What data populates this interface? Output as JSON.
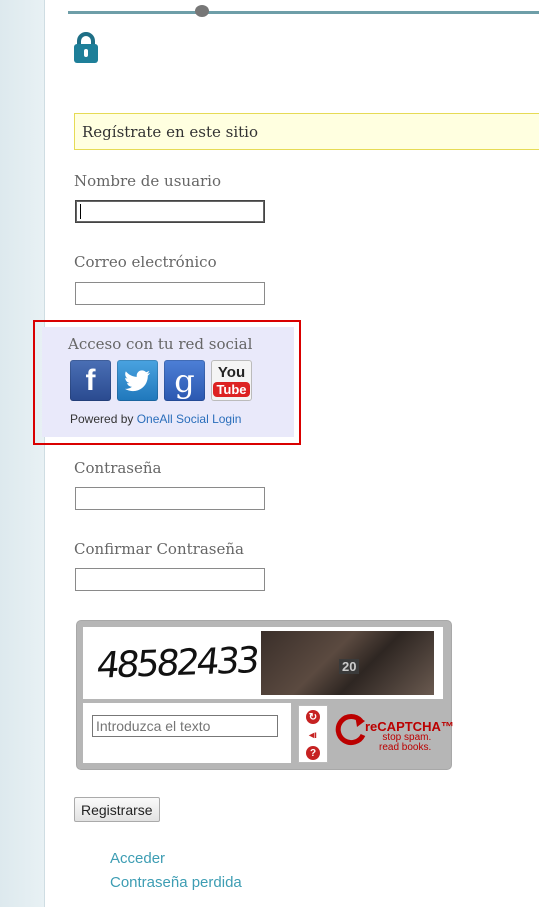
{
  "colors": {
    "accent_line": "#6e9ea8",
    "notice_bg": "#ffffe0",
    "highlight_border": "#d90000",
    "social_bg": "#e9e9fa",
    "link": "#3d9db3"
  },
  "header": {
    "icon": "lock-icon"
  },
  "notice": {
    "text": "Regístrate en este sitio"
  },
  "form": {
    "username_label": "Nombre de usuario",
    "username_value": "",
    "email_label": "Correo electrónico",
    "email_value": "",
    "password_label": "Contraseña",
    "confirm_label": "Confirmar Contraseña",
    "submit_label": "Registrarse"
  },
  "social": {
    "title": "Acceso con tu red social",
    "providers": [
      {
        "name": "facebook",
        "glyph": "f",
        "icon": "facebook-icon"
      },
      {
        "name": "twitter",
        "glyph": "t",
        "icon": "twitter-icon"
      },
      {
        "name": "google",
        "glyph": "g",
        "icon": "google-icon"
      },
      {
        "name": "youtube",
        "glyph_top": "You",
        "glyph_bottom": "Tube",
        "icon": "youtube-icon"
      }
    ],
    "powered_prefix": "Powered by ",
    "powered_link": "OneAll Social Login"
  },
  "captcha": {
    "challenge_text": "48582433",
    "photo_number": "20",
    "input_placeholder": "Introduzca el texto",
    "brand": "reCAPTCHA™",
    "tagline_1": "stop spam.",
    "tagline_2": "read books."
  },
  "links": {
    "login": "Acceder",
    "lost_password": "Contraseña perdida"
  }
}
